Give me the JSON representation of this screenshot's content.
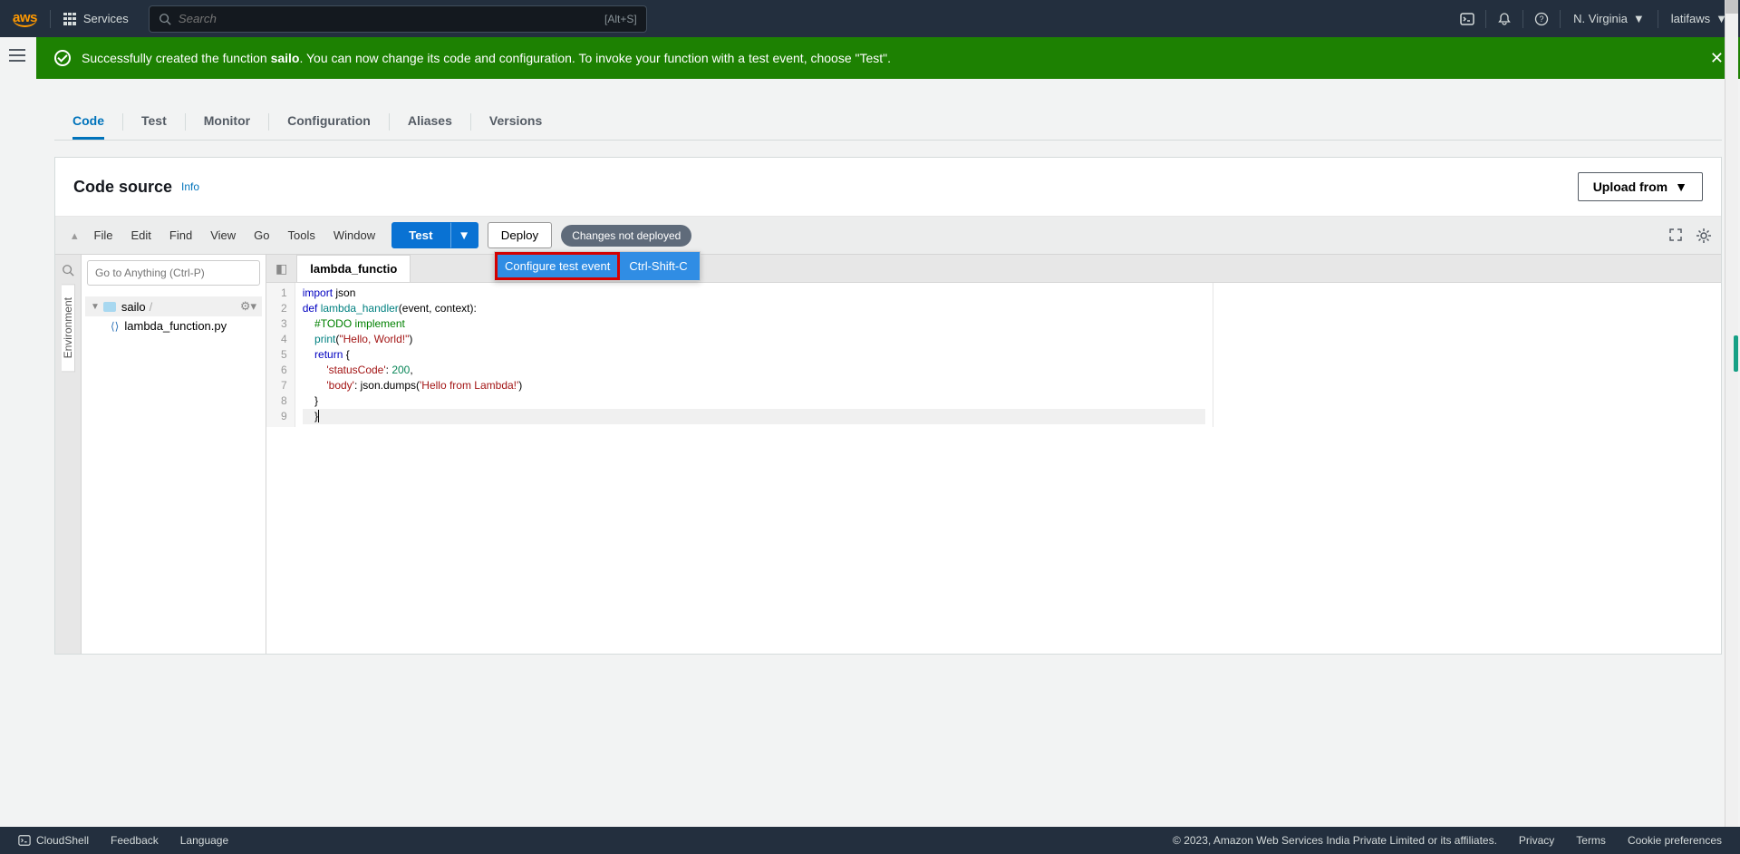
{
  "topnav": {
    "logo": "aws",
    "services": "Services",
    "search_placeholder": "Search",
    "search_kbd": "[Alt+S]",
    "region": "N. Virginia",
    "user": "latifaws"
  },
  "banner": {
    "prefix": "Successfully created the function ",
    "name": "sailo",
    "suffix": ". You can now change its code and configuration. To invoke your function with a test event, choose \"Test\"."
  },
  "tabs": [
    "Code",
    "Test",
    "Monitor",
    "Configuration",
    "Aliases",
    "Versions"
  ],
  "card": {
    "title": "Code source",
    "info": "Info",
    "upload": "Upload from"
  },
  "editor_menu": [
    "File",
    "Edit",
    "Find",
    "View",
    "Go",
    "Tools",
    "Window"
  ],
  "buttons": {
    "test": "Test",
    "deploy": "Deploy",
    "status": "Changes not deployed"
  },
  "dropdown": {
    "label": "Configure test event",
    "shortcut": "Ctrl-Shift-C"
  },
  "sidebar": {
    "env": "Environment",
    "goto_placeholder": "Go to Anything (Ctrl-P)",
    "root": "sailo",
    "file": "lambda_function.py"
  },
  "tab_file": "lambda_functio",
  "code_lines": [
    "import json",
    "def lambda_handler(event, context):",
    "    #TODO implement",
    "    print(\"Hello, World!\")",
    "    return {",
    "        'statusCode': 200,",
    "        'body': json.dumps('Hello from Lambda!')",
    "    }",
    "    }"
  ],
  "footer": {
    "cloudshell": "CloudShell",
    "feedback": "Feedback",
    "language": "Language",
    "copyright": "© 2023, Amazon Web Services India Private Limited or its affiliates.",
    "privacy": "Privacy",
    "terms": "Terms",
    "cookies": "Cookie preferences"
  }
}
